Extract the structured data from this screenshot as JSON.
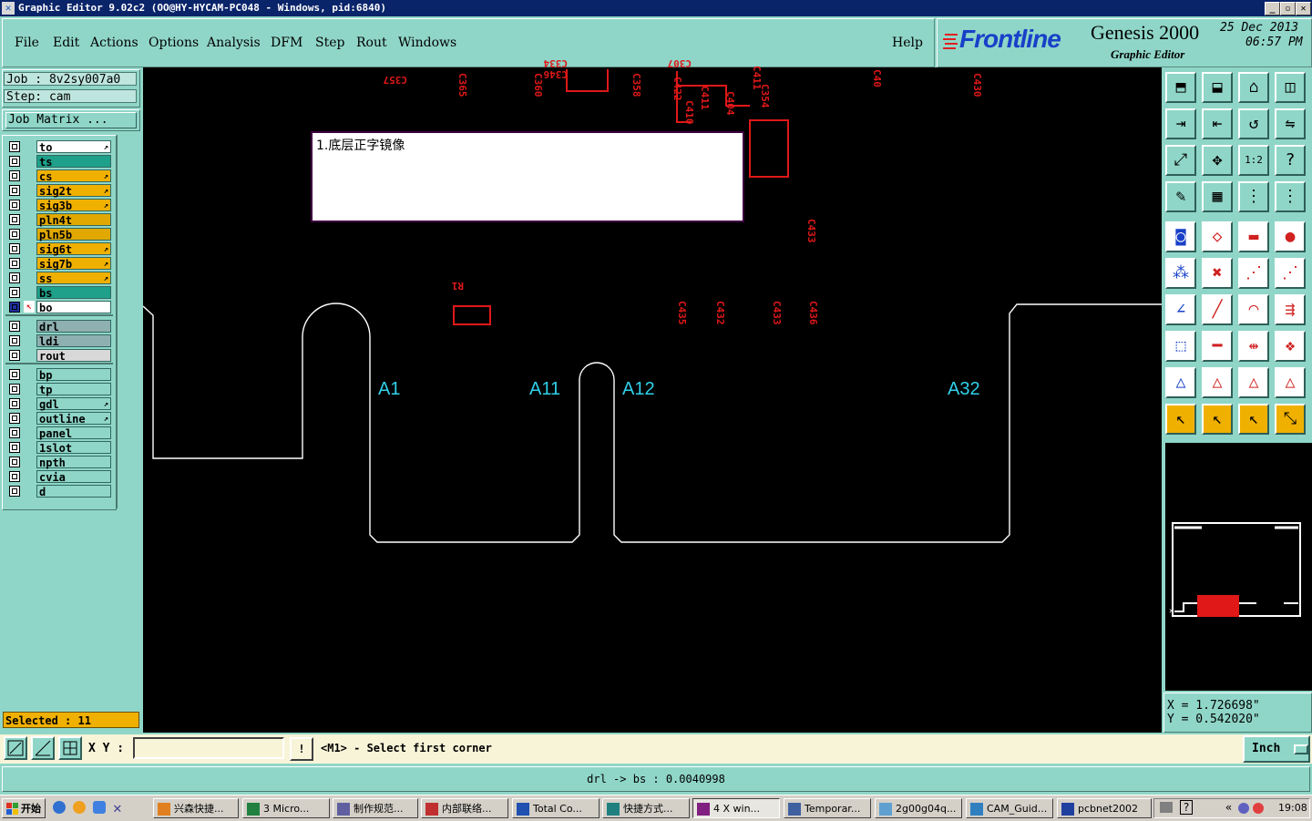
{
  "window": {
    "title": "Graphic Editor 9.02c2 (OO@HY-HYCAM-PC048 - Windows, pid:6840)",
    "app_icon": "x-app-icon",
    "controls": [
      "minimize",
      "maximize",
      "close"
    ]
  },
  "menu": {
    "items": [
      "File",
      "Edit",
      "Actions",
      "Options",
      "Analysis",
      "DFM",
      "Step",
      "Rout",
      "Windows"
    ],
    "help": "Help"
  },
  "brand": {
    "logo": "Frontline",
    "product": "Genesis 2000",
    "subtitle": "Graphic Editor",
    "date": "25 Dec 2013",
    "time": "06:57 PM"
  },
  "job": {
    "job_label": "Job : 8v2sy007a0",
    "step_label": "Step: cam",
    "matrix_button": "Job Matrix ..."
  },
  "layers": {
    "group1": [
      {
        "name": "to",
        "color": "#ffffff",
        "arrow": true,
        "active": false
      },
      {
        "name": "ts",
        "color": "#1ea08a",
        "arrow": false,
        "active": false
      },
      {
        "name": "cs",
        "color": "#f0b000",
        "arrow": true,
        "active": false
      },
      {
        "name": "sig2t",
        "color": "#f0b000",
        "arrow": true,
        "active": false
      },
      {
        "name": "sig3b",
        "color": "#f0b000",
        "arrow": true,
        "active": false
      },
      {
        "name": "pln4t",
        "color": "#e0a800",
        "arrow": false,
        "active": false
      },
      {
        "name": "pln5b",
        "color": "#e0a800",
        "arrow": false,
        "active": false
      },
      {
        "name": "sig6t",
        "color": "#f0b000",
        "arrow": true,
        "active": false
      },
      {
        "name": "sig7b",
        "color": "#f0b000",
        "arrow": true,
        "active": false
      },
      {
        "name": "ss",
        "color": "#f0b000",
        "arrow": true,
        "active": false
      },
      {
        "name": "bs",
        "color": "#1ea08a",
        "arrow": false,
        "active": false
      },
      {
        "name": "bo",
        "color": "#ffffff",
        "arrow": false,
        "active": true
      }
    ],
    "group2": [
      {
        "name": "drl",
        "color": "#8fb0b0"
      },
      {
        "name": "ldi",
        "color": "#8fb0b0"
      },
      {
        "name": "rout",
        "color": "#d8d8d8"
      }
    ],
    "group3": [
      {
        "name": "bp",
        "color": "#8fd6c8",
        "arrow": false
      },
      {
        "name": "tp",
        "color": "#8fd6c8",
        "arrow": false
      },
      {
        "name": "gdl",
        "color": "#8fd6c8",
        "arrow": true
      },
      {
        "name": "outline",
        "color": "#8fd6c8",
        "arrow": true
      },
      {
        "name": "panel",
        "color": "#8fd6c8",
        "arrow": false
      },
      {
        "name": "1slot",
        "color": "#8fd6c8",
        "arrow": false
      },
      {
        "name": "npth",
        "color": "#8fd6c8",
        "arrow": false
      },
      {
        "name": "cvia",
        "color": "#8fd6c8",
        "arrow": false
      },
      {
        "name": "d",
        "color": "#8fd6c8",
        "arrow": false
      }
    ],
    "selected_label": "Selected : 11"
  },
  "canvas": {
    "note": "1.底层正字镜像",
    "labels": [
      "A1",
      "A11",
      "A12",
      "A32"
    ],
    "refdes": [
      "C357",
      "C365",
      "C360",
      "C334",
      "C346",
      "C358",
      "C307",
      "C422",
      "C410",
      "C411",
      "C404",
      "C411",
      "C354",
      "C40",
      "C430",
      "C433",
      "C435",
      "C432",
      "C433",
      "C436",
      "R1"
    ],
    "outline_color": "#ffffff",
    "part_color": "#e01818",
    "label_color": "#30d0e8"
  },
  "coords": {
    "x": "X = 1.726698\"",
    "y": "Y = 0.542020\""
  },
  "command": {
    "xy_label": "X Y :",
    "xy_value": "",
    "prompt": "<M1> - Select first corner",
    "units": "Inch"
  },
  "status": {
    "text": "drl -> bs : 0.0040998"
  },
  "taskbar": {
    "start": "开始",
    "tasks": [
      "兴森快捷...",
      "3 Micro...",
      "制作规范...",
      "内部联络...",
      "Total Co...",
      "快捷方式...",
      "4 X win...",
      "Temporar...",
      "2g00g04q...",
      "CAM_Guid...",
      "pcbnet2002"
    ],
    "clock": "19:08"
  }
}
